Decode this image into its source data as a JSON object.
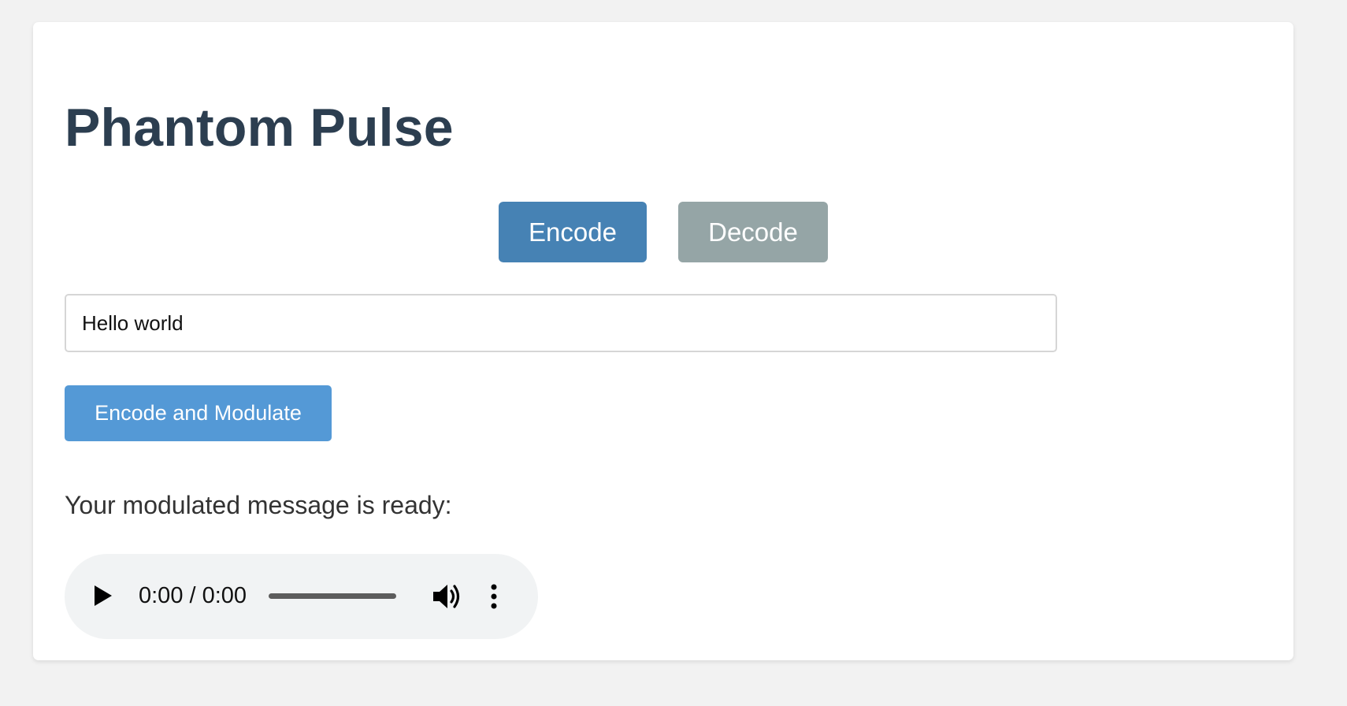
{
  "app": {
    "title": "Phantom Pulse"
  },
  "mode_tabs": {
    "encode_label": "Encode",
    "decode_label": "Decode",
    "active": "Encode"
  },
  "message_input": {
    "value": "Hello world"
  },
  "actions": {
    "encode_modulate_label": "Encode and Modulate"
  },
  "result": {
    "ready_text": "Your modulated message is ready:"
  },
  "audio_player": {
    "time_display": "0:00 / 0:00",
    "play_icon": "play-icon",
    "volume_icon": "volume-icon",
    "more_icon": "more-options-icon"
  },
  "colors": {
    "title": "#2c3e50",
    "encode_tab": "#4682b4",
    "decode_tab": "#95a5a6",
    "action_button": "#5499d6",
    "player_background": "#f1f3f4"
  }
}
